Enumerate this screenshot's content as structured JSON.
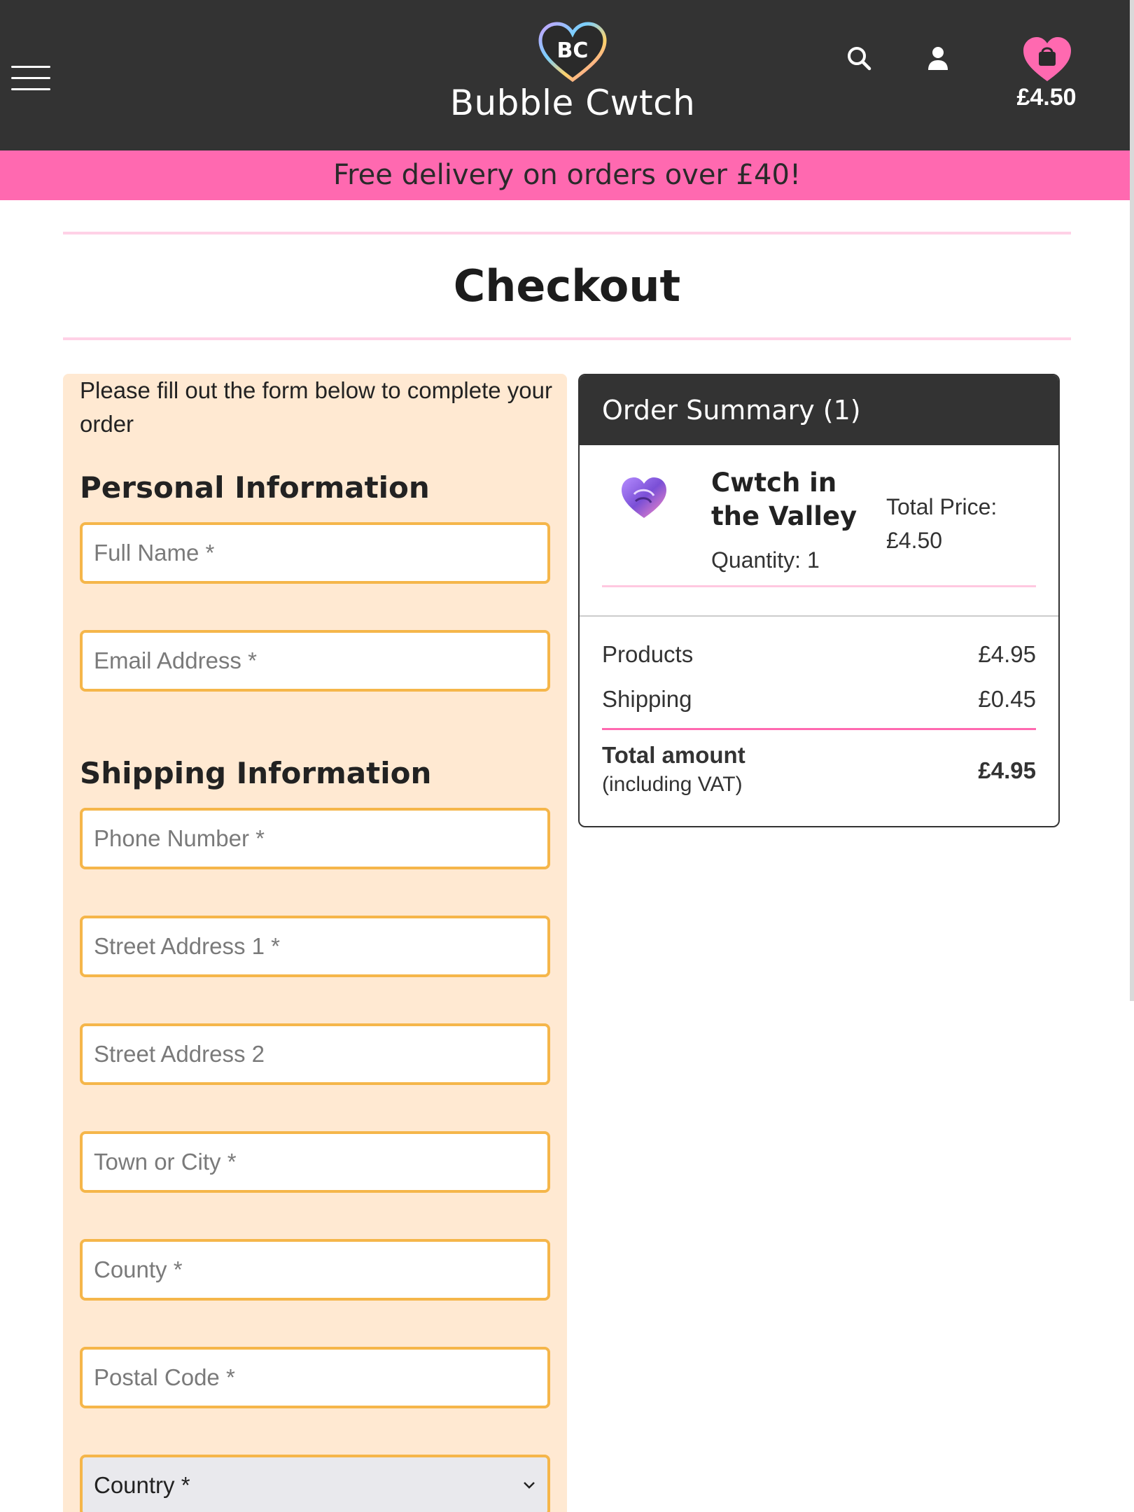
{
  "header": {
    "logo_text": "BC",
    "brand_name": "Bubble Cwtch",
    "cart_total": "£4.50"
  },
  "promo": {
    "text": "Free delivery on orders over £40!"
  },
  "page": {
    "title": "Checkout"
  },
  "form": {
    "intro": "Please fill out the form below to complete your order",
    "personal_heading": "Personal Information",
    "shipping_heading": "Shipping Information",
    "fields": {
      "full_name": "Full Name *",
      "email": "Email Address *",
      "phone": "Phone Number *",
      "street1": "Street Address 1 *",
      "street2": "Street Address 2",
      "town": "Town or City *",
      "county": "County *",
      "postal": "Postal Code *"
    },
    "country_selected": "Country *"
  },
  "summary": {
    "title": "Order Summary (1)",
    "item": {
      "name": "Cwtch in the Valley",
      "quantity": "Quantity: 1",
      "price_label": "Total Price:",
      "price": "£4.50"
    },
    "products_label": "Products",
    "products_value": "£4.95",
    "shipping_label": "Shipping",
    "shipping_value": "£0.45",
    "total_label": "Total amount",
    "total_sub": "(including VAT)",
    "total_value": "£4.95"
  },
  "colors": {
    "header_bg": "#333333",
    "promo_bg": "#ff69b0",
    "form_bg": "#ffe9d2",
    "field_border": "#f5b64a",
    "accent_pink": "#ff69b0"
  },
  "icons": [
    "hamburger-icon",
    "search-icon",
    "account-icon",
    "shopping-bag-heart-icon",
    "chevron-down-icon"
  ]
}
